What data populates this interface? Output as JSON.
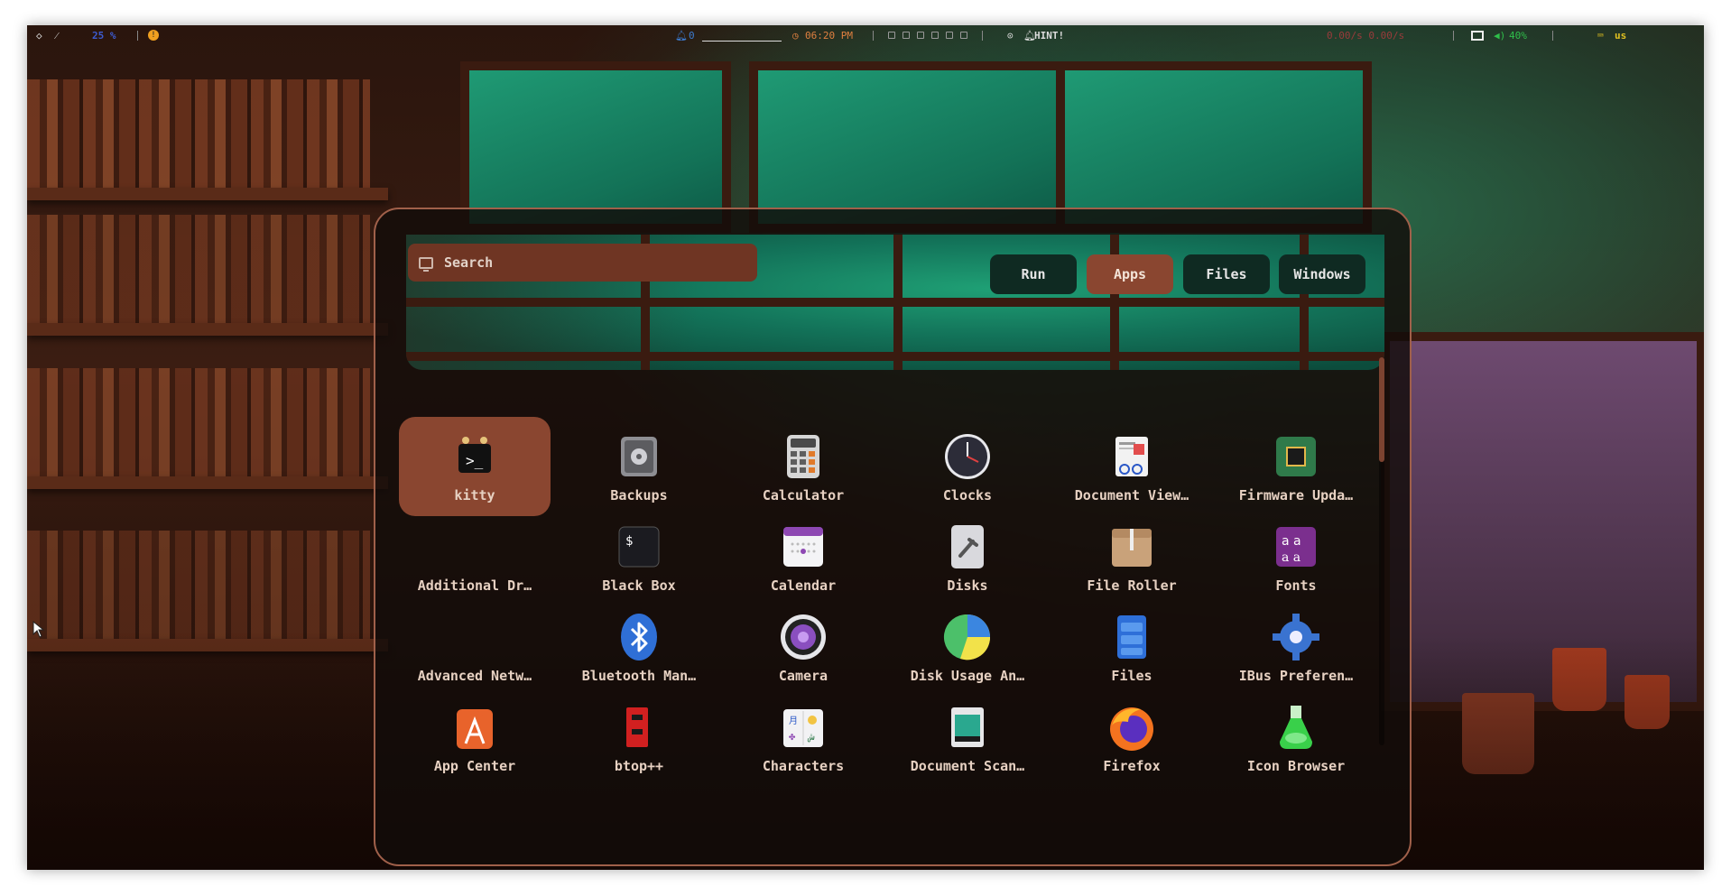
{
  "topbar": {
    "left_indicator_1": "◇",
    "left_indicator_2": "⁄",
    "workspaces_label": "25 %",
    "alert_label": "!",
    "notif_count": "0",
    "clock": "06:20 PM",
    "hint": "HINT!",
    "net_stats": "0.00/s  0.00/s",
    "battery": "40%",
    "keyboard_layout": "us"
  },
  "launcher": {
    "search": {
      "placeholder": "Search"
    },
    "modes": [
      {
        "label": "Run"
      },
      {
        "label": "Apps"
      },
      {
        "label": "Files"
      },
      {
        "label": "Windows"
      }
    ],
    "active_mode": "Apps",
    "apps": [
      {
        "label": "kitty",
        "icon": "kitty-icon"
      },
      {
        "label": "Backups",
        "icon": "backups-icon"
      },
      {
        "label": "Calculator",
        "icon": "calculator-icon"
      },
      {
        "label": "Clocks",
        "icon": "clock-icon"
      },
      {
        "label": "Document View…",
        "icon": "document-viewer-icon"
      },
      {
        "label": "Firmware Upda…",
        "icon": "firmware-icon"
      },
      {
        "label": "Additional Dr…",
        "icon": "additional-drivers-icon"
      },
      {
        "label": "Black Box",
        "icon": "terminal-icon"
      },
      {
        "label": "Calendar",
        "icon": "calendar-icon"
      },
      {
        "label": "Disks",
        "icon": "disks-icon"
      },
      {
        "label": "File Roller",
        "icon": "archive-icon"
      },
      {
        "label": "Fonts",
        "icon": "fonts-icon"
      },
      {
        "label": "Advanced Netw…",
        "icon": "network-icon"
      },
      {
        "label": "Bluetooth Man…",
        "icon": "bluetooth-icon"
      },
      {
        "label": "Camera",
        "icon": "camera-icon"
      },
      {
        "label": "Disk Usage An…",
        "icon": "pie-chart-icon"
      },
      {
        "label": "Files",
        "icon": "files-icon"
      },
      {
        "label": "IBus Preferen…",
        "icon": "gear-icon"
      },
      {
        "label": "App Center",
        "icon": "app-center-icon"
      },
      {
        "label": "btop++",
        "icon": "btop-icon"
      },
      {
        "label": "Characters",
        "icon": "characters-icon"
      },
      {
        "label": "Document Scan…",
        "icon": "scanner-icon"
      },
      {
        "label": "Firefox",
        "icon": "firefox-icon"
      },
      {
        "label": "Icon Browser",
        "icon": "flask-icon"
      }
    ]
  },
  "colors": {
    "accent": "#8a4630",
    "search_bg": "#6f3523",
    "text": "#e7d1c2"
  }
}
